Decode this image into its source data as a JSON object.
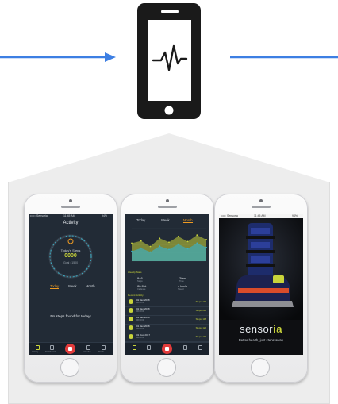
{
  "colors": {
    "arrow": "#3d7fe3",
    "device": "#1a1a1a",
    "house": "#ededed",
    "app_bg": "#222b36",
    "accent_green": "#c9d43a",
    "accent_orange": "#ee9b22",
    "accent_blue": "#3bb0c7",
    "record_red": "#e23b3b"
  },
  "icons": {
    "device": "phone-heartbeat-icon"
  },
  "phone1": {
    "status": {
      "carrier": "••••○ Sensoria",
      "time": "11:45 AM",
      "battery": "94%"
    },
    "title": "Activity",
    "ring_label": "Today's Steps",
    "steps": "0000",
    "goal": "Goal : 1500",
    "tabs": [
      "Today",
      "Week",
      "Month"
    ],
    "empty_message": "No steps found for today!",
    "nav": [
      "Activity",
      "Dashboards",
      "",
      "Calendar",
      "Profile"
    ]
  },
  "phone2": {
    "tabs": [
      "Today",
      "Week",
      "Month"
    ],
    "stats_title": "Weekly Stats",
    "stats": [
      {
        "value": "946",
        "label": "Steps"
      },
      {
        "value": "20m",
        "label": "Time"
      },
      {
        "value": "80.8%",
        "label": "Cadence"
      },
      {
        "value": "4 km/h",
        "label": "Speed"
      }
    ],
    "list_title": "Recent Activity",
    "entries": [
      {
        "date": "02 Jan 2018",
        "time": "00:00:00",
        "right": "Steps: 170"
      },
      {
        "date": "02 Jan 2018",
        "time": "00:00:00",
        "right": "Steps: 216"
      },
      {
        "date": "01 Jan 2018",
        "time": "00:00:00",
        "right": "Steps: 198"
      },
      {
        "date": "01 Jan 2018",
        "time": "00:00:00",
        "right": "Steps: 120"
      },
      {
        "date": "31 Dec 2017",
        "time": "00:00:00",
        "right": "Steps: 140"
      }
    ],
    "chart_data": {
      "type": "area",
      "series": [
        {
          "values": [
            55,
            62,
            45,
            70,
            58,
            76,
            60,
            80,
            66
          ]
        },
        {
          "values": [
            30,
            40,
            28,
            46,
            36,
            52,
            38,
            55,
            42
          ]
        }
      ],
      "ylim": [
        0,
        100
      ]
    }
  },
  "phone3": {
    "status": {
      "carrier": "••••○ Sensoria",
      "time": "11:45 AM",
      "battery": "94%"
    },
    "brand_prefix": "sensor",
    "brand_suffix": "ia",
    "tagline": "Better health, just steps away"
  }
}
